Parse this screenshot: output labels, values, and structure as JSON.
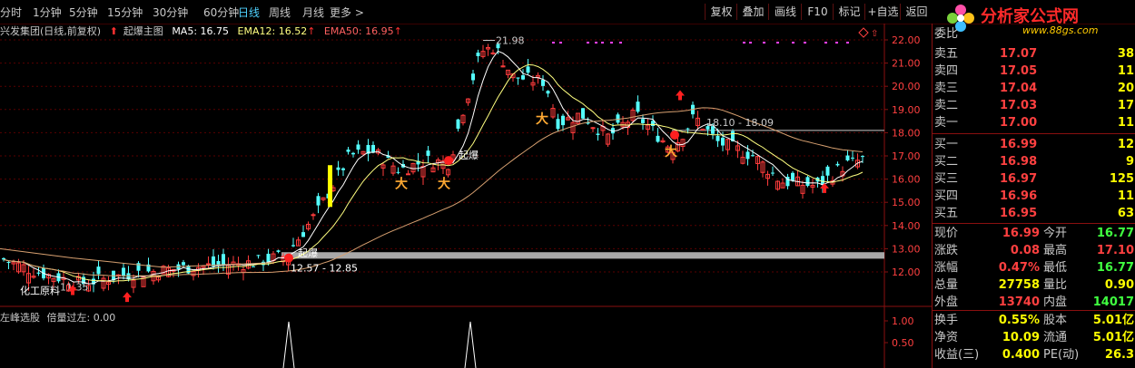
{
  "period_tabs": [
    "分时",
    "1分钟",
    "5分钟",
    "15分钟",
    "30分钟",
    "60分钟",
    "日线",
    "周线",
    "月线",
    "更多 >"
  ],
  "active_tab": "日线",
  "toolbar": [
    "复权",
    "叠加",
    "画线",
    "F10",
    "标记",
    "+自选",
    "返回"
  ],
  "logo": {
    "title": "分析家公式网",
    "url": "www.88gs.com"
  },
  "chart_header": {
    "stock": "兴发集团(日线,前复权)",
    "formula": "起爆主图",
    "ma5": "MA5: 16.75",
    "ema12": "EMA12: 16.52",
    "ema50": "EMA50: 16.95"
  },
  "indicator_header": {
    "name": "左峰选股",
    "value": "倍量过左: 0.00"
  },
  "chart_data": {
    "type": "candlestick",
    "price_axis": {
      "min": 11.0,
      "max": 22.0,
      "ticks": [
        "22.00",
        "21.00",
        "20.00",
        "19.00",
        "18.00",
        "17.00",
        "16.00",
        "15.00",
        "14.00",
        "13.00",
        "12.00"
      ]
    },
    "indicator_axis": {
      "ticks": [
        "1.00",
        "0.50"
      ]
    },
    "annotations": [
      {
        "text": "21.98",
        "price": 21.98
      },
      {
        "text": "18.10 - 18.09",
        "price": 18.1
      },
      {
        "text": "12.57 - 12.85",
        "price": 12.57
      },
      {
        "text": "11.35",
        "price": 11.35
      },
      {
        "text": "起爆",
        "price": 16.9
      },
      {
        "text": "起爆",
        "price": 12.5
      },
      {
        "text": "化工原料",
        "price": 11.5
      }
    ],
    "support_band": {
      "low": 12.57,
      "high": 12.85
    },
    "resistance_line": 18.1,
    "colors": {
      "up": "#ff3c3c",
      "down": "#54ffff",
      "ma5": "#ffffff",
      "ema12": "#ffff80",
      "ema50": "#d7a070"
    }
  },
  "quote": {
    "title": "委比",
    "asks": [
      {
        "label": "卖五",
        "price": "17.07",
        "vol": "38"
      },
      {
        "label": "卖四",
        "price": "17.05",
        "vol": "11"
      },
      {
        "label": "卖三",
        "price": "17.04",
        "vol": "20"
      },
      {
        "label": "卖二",
        "price": "17.03",
        "vol": "17"
      },
      {
        "label": "卖一",
        "price": "17.00",
        "vol": "11"
      }
    ],
    "bids": [
      {
        "label": "买一",
        "price": "16.99",
        "vol": "12"
      },
      {
        "label": "买二",
        "price": "16.98",
        "vol": "9"
      },
      {
        "label": "买三",
        "price": "16.97",
        "vol": "125"
      },
      {
        "label": "买四",
        "price": "16.96",
        "vol": "11"
      },
      {
        "label": "买五",
        "price": "16.95",
        "vol": "63"
      }
    ],
    "stats": [
      {
        "l1": "现价",
        "v1": "16.99",
        "c1": "#ff4040",
        "l2": "今开",
        "v2": "16.77",
        "c2": "#40ff40"
      },
      {
        "l1": "涨跌",
        "v1": "0.08",
        "c1": "#ff4040",
        "l2": "最高",
        "v2": "17.10",
        "c2": "#ff4040"
      },
      {
        "l1": "涨幅",
        "v1": "0.47%",
        "c1": "#ff4040",
        "l2": "最低",
        "v2": "16.77",
        "c2": "#40ff40"
      },
      {
        "l1": "总量",
        "v1": "27758",
        "c1": "#ffff00",
        "l2": "量比",
        "v2": "0.90",
        "c2": "#ffff00"
      },
      {
        "l1": "外盘",
        "v1": "13740",
        "c1": "#ff4040",
        "l2": "内盘",
        "v2": "14017",
        "c2": "#40ff40"
      }
    ],
    "stats2": [
      {
        "l1": "换手",
        "v1": "0.55%",
        "c1": "#ffff00",
        "l2": "股本",
        "v2": "5.01亿",
        "c2": "#ffff00"
      },
      {
        "l1": "净资",
        "v1": "10.09",
        "c1": "#ffff00",
        "l2": "流通",
        "v2": "5.01亿",
        "c2": "#ffff00"
      },
      {
        "l1": "收益(三)",
        "v1": "0.400",
        "c1": "#ffff00",
        "l2": "PE(动)",
        "v2": "26.3",
        "c2": "#ffff00"
      }
    ]
  }
}
